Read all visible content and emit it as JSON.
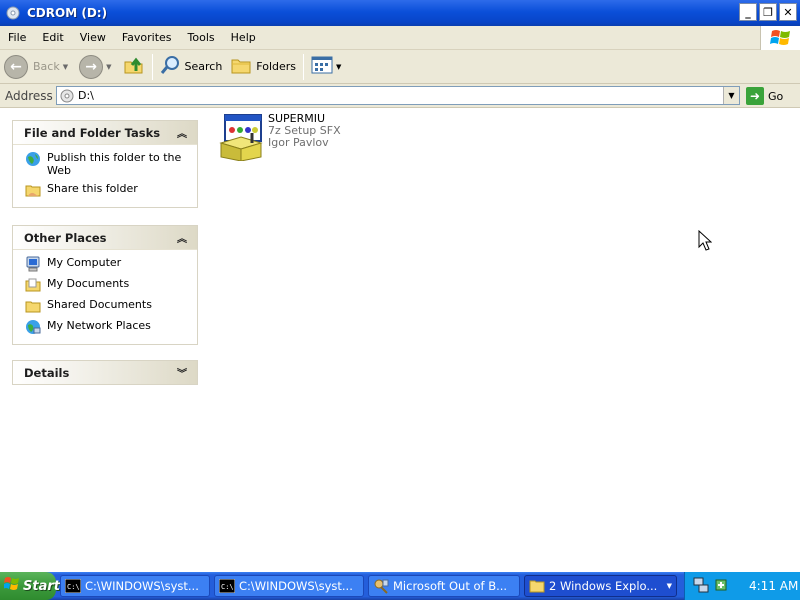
{
  "window": {
    "title": "CDROM (D:)",
    "controls": [
      "minimize",
      "restore",
      "close"
    ]
  },
  "menu": [
    "File",
    "Edit",
    "View",
    "Favorites",
    "Tools",
    "Help"
  ],
  "toolbar": {
    "back_label": "Back",
    "search_label": "Search",
    "folders_label": "Folders"
  },
  "address": {
    "label": "Address",
    "value": "D:\\",
    "go_label": "Go"
  },
  "sidebar": {
    "file_tasks": {
      "title": "File and Folder Tasks",
      "items": [
        {
          "label": "Publish this folder to the Web",
          "icon": "globe-icon"
        },
        {
          "label": "Share this folder",
          "icon": "share-folder-icon"
        }
      ]
    },
    "other_places": {
      "title": "Other Places",
      "items": [
        {
          "label": "My Computer",
          "icon": "computer-icon"
        },
        {
          "label": "My Documents",
          "icon": "documents-folder-icon"
        },
        {
          "label": "Shared Documents",
          "icon": "shared-folder-icon"
        },
        {
          "label": "My Network Places",
          "icon": "network-icon"
        }
      ]
    },
    "details": {
      "title": "Details"
    }
  },
  "files": [
    {
      "name": "SUPERMIU",
      "description": "7z Setup SFX",
      "company": "Igor Pavlov",
      "icon": "installer-icon"
    }
  ],
  "taskbar": {
    "start_label": "Start",
    "tasks": [
      {
        "label": "C:\\WINDOWS\\syst...",
        "icon": "console-icon"
      },
      {
        "label": "C:\\WINDOWS\\syst...",
        "icon": "console-icon"
      },
      {
        "label": "Microsoft Out of B...",
        "icon": "setup-icon"
      },
      {
        "label": "2 Windows Explo...",
        "icon": "folder-icon",
        "active": true
      }
    ],
    "clock": "4:11 AM"
  },
  "colors": {
    "title_bar": "#0b4fd9",
    "taskbar": "#245edb",
    "start_button": "#3c9a3c",
    "tray": "#0f9be8",
    "panel_background": "#f2f0e6"
  }
}
